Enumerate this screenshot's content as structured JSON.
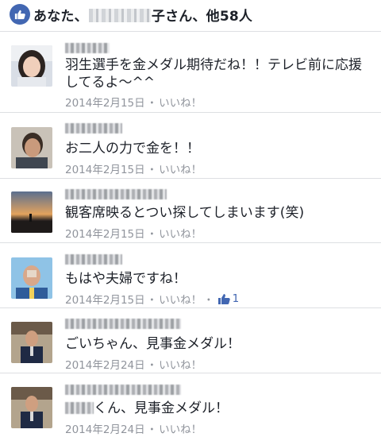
{
  "likes_bar": {
    "prefix": "あなた、",
    "suffix_char": "子",
    "suffix": "さん、他58人",
    "icon": "thumbs-up-icon",
    "accent": "#4267b2"
  },
  "comments": [
    {
      "text": "羽生選手を金メダル期待だね！！テレビ前に応援してるよ〜^^",
      "date": "2014年2月15日",
      "like_label": "いいね！"
    },
    {
      "text": "お二人の力で金を！！",
      "date": "2014年2月15日",
      "like_label": "いいね！"
    },
    {
      "text": "観客席映るとつい探してしまいます(笑)",
      "date": "2014年2月15日",
      "like_label": "いいね！"
    },
    {
      "text": "もはや夫婦ですね！",
      "date": "2014年2月15日",
      "like_label": "いいね！",
      "like_count": "1"
    },
    {
      "text": "ごいちゃん、見事金メダル！",
      "date": "2014年2月24日",
      "like_label": "いいね！"
    },
    {
      "text": "くん、見事金メダル！",
      "date": "2014年2月24日",
      "like_label": "いいね！"
    }
  ],
  "meta_separator": "・"
}
